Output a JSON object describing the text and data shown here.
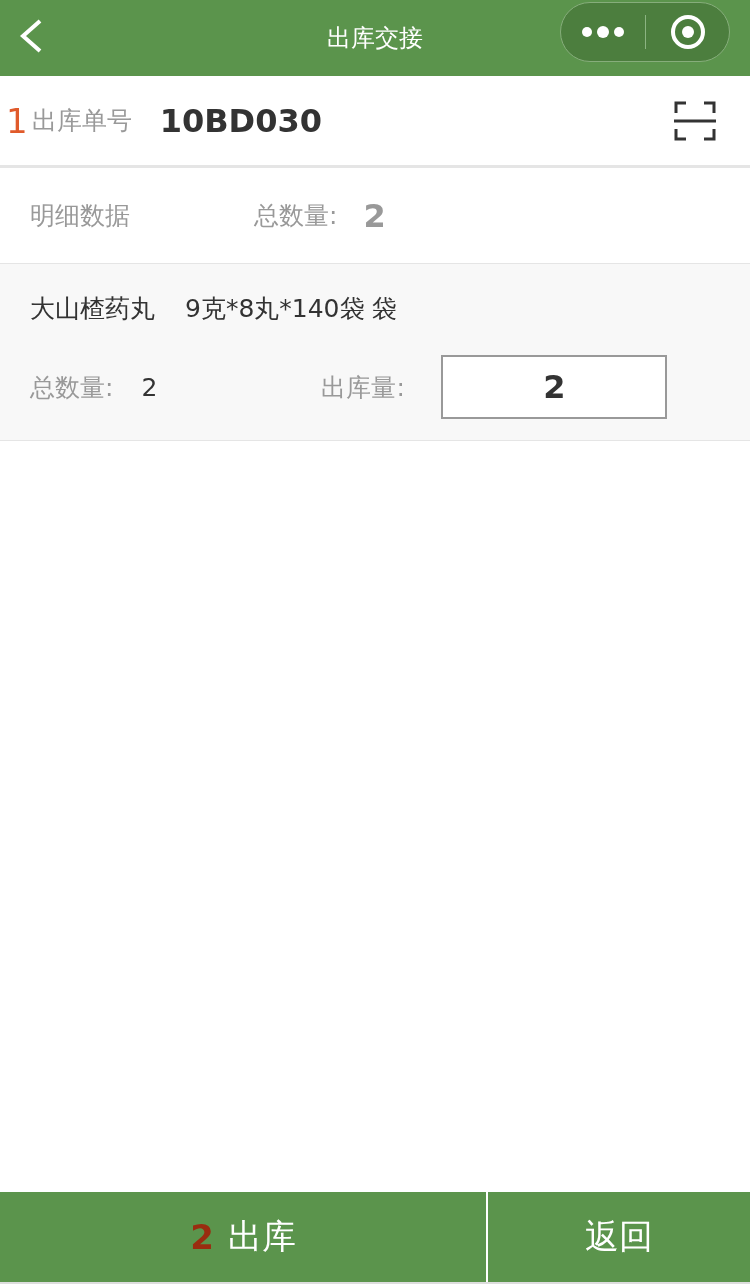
{
  "nav_bar": {
    "title": "出库交接"
  },
  "order": {
    "marker": "1",
    "label": "出库单号",
    "value": "10BD030"
  },
  "summary": {
    "label": "明细数据",
    "total_label": "总数量:",
    "total": "2"
  },
  "items": [
    {
      "name": "大山楂药丸",
      "spec": "9克*8丸*140袋 袋",
      "total_label": "总数量:",
      "total": "2",
      "out_label": "出库量:",
      "out_value": "2"
    }
  ],
  "footer": {
    "marker": "2",
    "confirm": "出库",
    "back": "返回"
  }
}
